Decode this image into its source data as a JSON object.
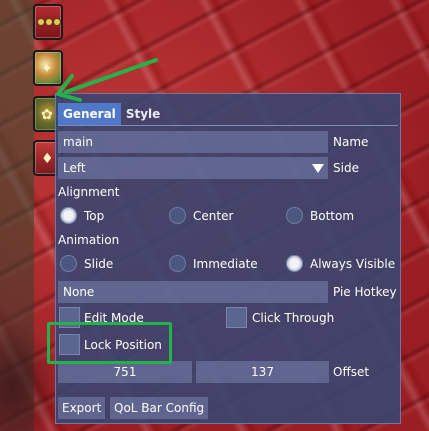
{
  "panel": {
    "tabs": [
      {
        "label": "General",
        "active": true
      },
      {
        "label": "Style",
        "active": false
      }
    ],
    "name_field": {
      "value": "main",
      "label": "Name"
    },
    "side_field": {
      "value": "Left",
      "label": "Side"
    },
    "alignment": {
      "heading": "Alignment",
      "options": [
        {
          "label": "Top",
          "selected": true
        },
        {
          "label": "Center",
          "selected": false
        },
        {
          "label": "Bottom",
          "selected": false
        }
      ]
    },
    "animation": {
      "heading": "Animation",
      "options": [
        {
          "label": "Slide",
          "selected": false
        },
        {
          "label": "Immediate",
          "selected": false
        },
        {
          "label": "Always Visible",
          "selected": true
        }
      ]
    },
    "pie_hotkey": {
      "value": "None",
      "label": "Pie Hotkey"
    },
    "checkboxes": [
      {
        "label": "Edit Mode",
        "checked": false
      },
      {
        "label": "Click Through",
        "checked": false
      },
      {
        "label": "Lock Position",
        "checked": false
      }
    ],
    "offset": {
      "x": "751",
      "y": "137",
      "label": "Offset"
    },
    "buttons": {
      "export": "Export",
      "config": "QoL Bar Config"
    }
  },
  "colors": {
    "highlight": "#24b34a",
    "arrow": "#24b34a",
    "tab_active": "#4f78c8",
    "panel_bg": "#3a4670"
  },
  "icons": {
    "menu_button": "ellipsis-icon",
    "item_buttons": [
      "item-icon",
      "item-icon",
      "item-icon"
    ],
    "dropdown": "triangle-down-icon"
  }
}
